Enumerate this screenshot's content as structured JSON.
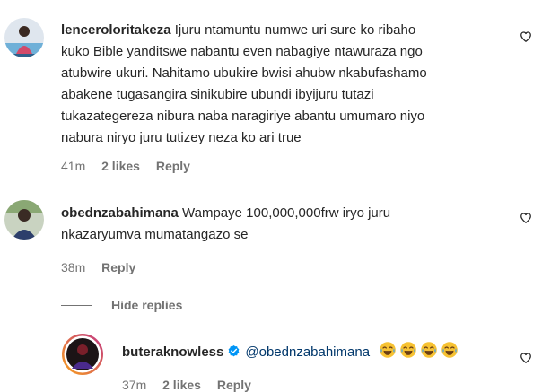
{
  "comments": [
    {
      "username": "lenceroloritakeza",
      "text_lines": [
        "Ijuru ntamuntu numwe uri sure ko ribaho",
        "kuko Bible yanditswe nabantu even nabagiye ntawuraza ngo",
        "atubwire ukuri. Nahitamo ubukire bwisi ahubw nkabufashamo",
        "abakene tugasangira sinikubire ubundi ibyijuru tutazi",
        "tukazategereza nibura naba naragiriye abantu umumaro niyo",
        "nabura niryo juru tutizey neza ko ari true"
      ],
      "time": "41m",
      "likes": "2 likes",
      "reply": "Reply"
    },
    {
      "username": "obednzabahimana",
      "text_lines": [
        "Wampaye 100,000,000frw iryo juru",
        "nkazaryumva mumatangazo se"
      ],
      "time": "38m",
      "reply": "Reply"
    }
  ],
  "hide_replies": "Hide replies",
  "reply_comment": {
    "username": "buteraknowless",
    "mention": "@obednzabahimana",
    "emoji_count": 4,
    "time": "37m",
    "likes": "2 likes",
    "reply": "Reply"
  },
  "icons": {
    "heart": "heart-outline-icon",
    "verified": "verified-badge-icon",
    "emoji": "face-with-tears-of-joy-emoji"
  },
  "colors": {
    "text": "#262626",
    "secondary": "#737373",
    "mention": "#00376b",
    "verified": "#0095f6",
    "story_ring_start": "#f9a11b",
    "story_ring_end": "#c13584"
  }
}
